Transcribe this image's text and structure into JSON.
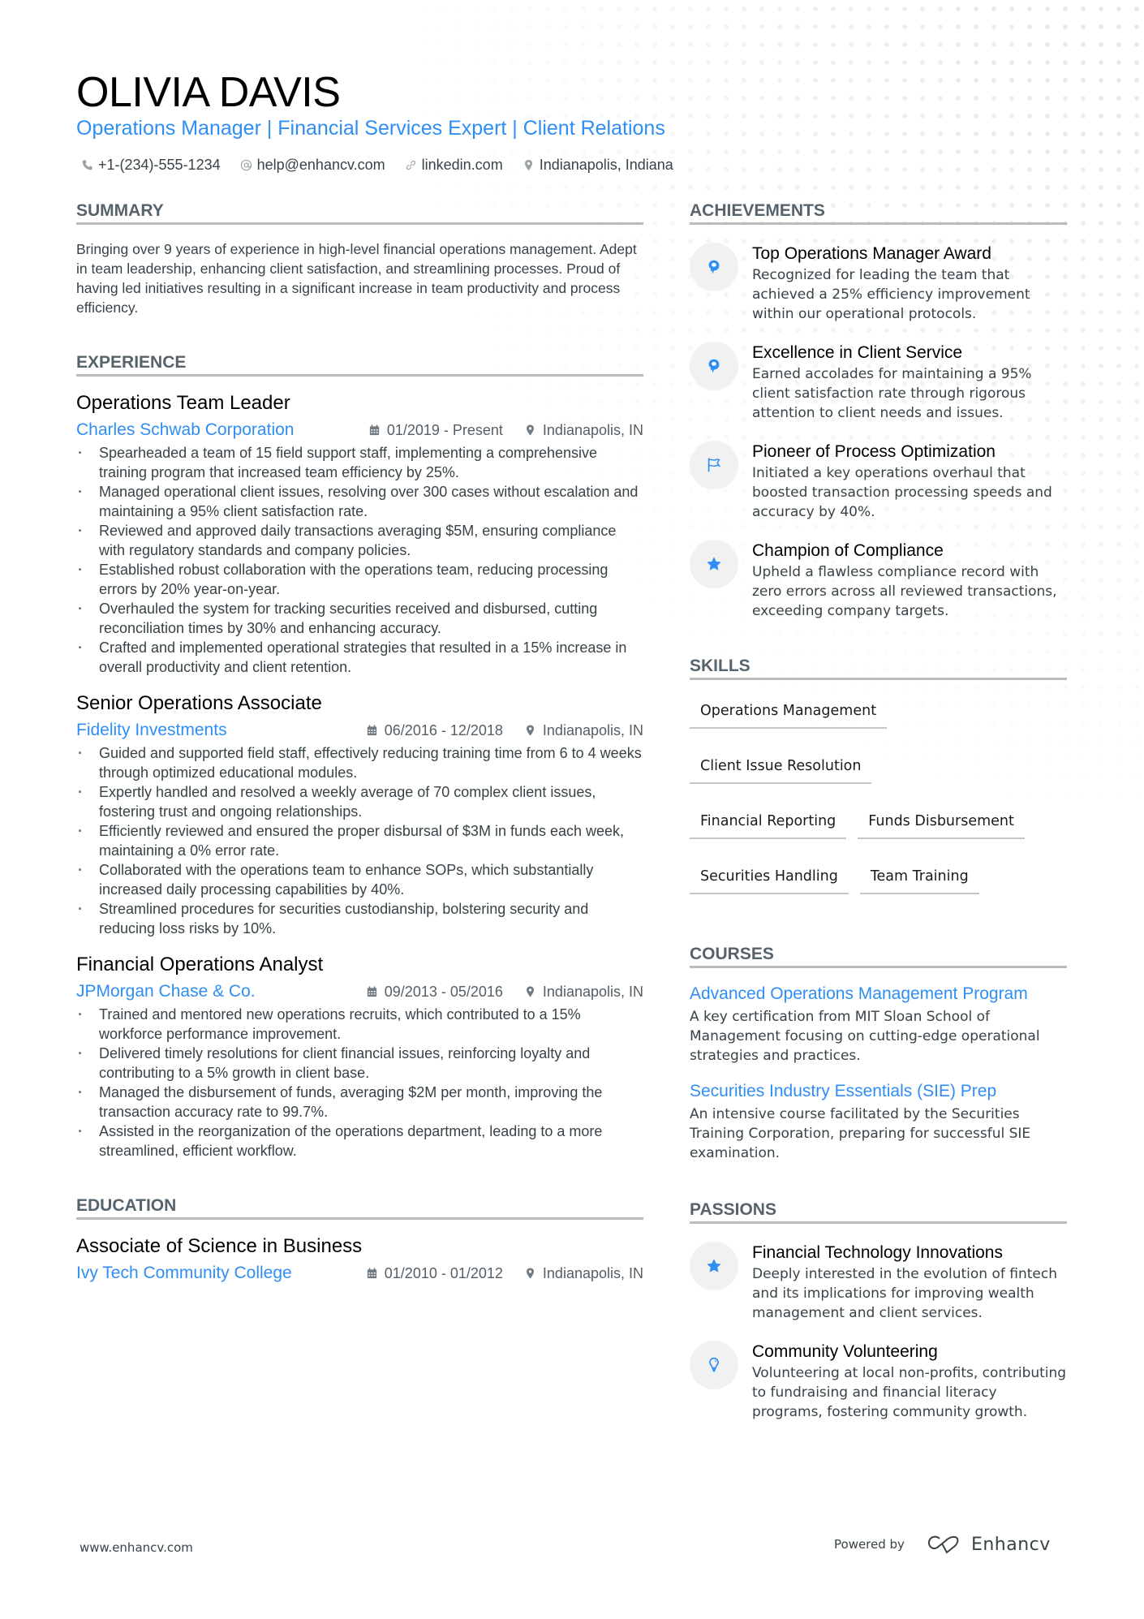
{
  "header": {
    "name": "OLIVIA DAVIS",
    "subtitle": "Operations Manager | Financial Services Expert | Client Relations",
    "contacts": [
      {
        "icon": "phone-icon",
        "text": "+1-(234)-555-1234"
      },
      {
        "icon": "at-icon",
        "text": "help@enhancv.com"
      },
      {
        "icon": "link-icon",
        "text": "linkedin.com"
      },
      {
        "icon": "location-pin-icon",
        "text": "Indianapolis, Indiana"
      }
    ]
  },
  "summary": {
    "title": "SUMMARY",
    "text": "Bringing over 9 years of experience in high-level financial operations management. Adept in team leadership, enhancing client satisfaction, and streamlining processes. Proud of having led initiatives resulting in a significant increase in team productivity and process efficiency."
  },
  "experience": {
    "title": "EXPERIENCE",
    "jobs": [
      {
        "role": "Operations Team Leader",
        "company": "Charles Schwab Corporation",
        "dates": "01/2019 - Present",
        "location": "Indianapolis, IN",
        "bullets": [
          "Spearheaded a team of 15 field support staff, implementing a comprehensive training program that increased team efficiency by 25%.",
          "Managed operational client issues, resolving over 300 cases without escalation and maintaining a 95% client satisfaction rate.",
          "Reviewed and approved daily transactions averaging $5M, ensuring compliance with regulatory standards and company policies.",
          "Established robust collaboration with the operations team, reducing processing errors by 20% year-on-year.",
          "Overhauled the system for tracking securities received and disbursed, cutting reconciliation times by 30% and enhancing accuracy.",
          "Crafted and implemented operational strategies that resulted in a 15% increase in overall productivity and client retention."
        ]
      },
      {
        "role": "Senior Operations Associate",
        "company": "Fidelity Investments",
        "dates": "06/2016 - 12/2018",
        "location": "Indianapolis, IN",
        "bullets": [
          "Guided and supported field staff, effectively reducing training time from 6 to 4 weeks through optimized educational modules.",
          "Expertly handled and resolved a weekly average of 70 complex client issues, fostering trust and ongoing relationships.",
          "Efficiently reviewed and ensured the proper disbursal of $3M in funds each week, maintaining a 0% error rate.",
          "Collaborated with the operations team to enhance SOPs, which substantially increased daily processing capabilities by 40%.",
          "Streamlined procedures for securities custodianship, bolstering security and reducing loss risks by 10%."
        ]
      },
      {
        "role": "Financial Operations Analyst",
        "company": "JPMorgan Chase & Co.",
        "dates": "09/2013 - 05/2016",
        "location": "Indianapolis, IN",
        "bullets": [
          "Trained and mentored new operations recruits, which contributed to a 15% workforce performance improvement.",
          "Delivered timely resolutions for client financial issues, reinforcing loyalty and contributing to a 5% growth in client base.",
          "Managed the disbursement of funds, averaging $2M per month, improving the transaction accuracy rate to 99.7%.",
          "Assisted in the reorganization of the operations department, leading to a more streamlined, efficient workflow."
        ]
      }
    ]
  },
  "education": {
    "title": "EDUCATION",
    "items": [
      {
        "degree": "Associate of Science in Business",
        "school": "Ivy Tech Community College",
        "dates": "01/2010 - 01/2012",
        "location": "Indianapolis, IN"
      }
    ]
  },
  "achievements": {
    "title": "ACHIEVEMENTS",
    "items": [
      {
        "icon": "head-brain-icon",
        "title": "Top Operations Manager Award",
        "desc": "Recognized for leading the team that achieved a 25% efficiency improvement within our operational protocols."
      },
      {
        "icon": "head-brain-icon",
        "title": "Excellence in Client Service",
        "desc": "Earned accolades for maintaining a 95% client satisfaction rate through rigorous attention to client needs and issues."
      },
      {
        "icon": "flag-icon",
        "title": "Pioneer of Process Optimization",
        "desc": "Initiated a key operations overhaul that boosted transaction processing speeds and accuracy by 40%."
      },
      {
        "icon": "star-icon",
        "title": "Champion of Compliance",
        "desc": "Upheld a flawless compliance record with zero errors across all reviewed transactions, exceeding company targets."
      }
    ]
  },
  "skills": {
    "title": "SKILLS",
    "items": [
      "Operations Management",
      "Client Issue Resolution",
      "Financial Reporting",
      "Funds Disbursement",
      "Securities Handling",
      "Team Training"
    ]
  },
  "courses": {
    "title": "COURSES",
    "items": [
      {
        "title": "Advanced Operations Management Program",
        "desc": "A key certification from MIT Sloan School of Management focusing on cutting-edge operational strategies and practices."
      },
      {
        "title": "Securities Industry Essentials (SIE) Prep",
        "desc": "An intensive course facilitated by the Securities Training Corporation, preparing for successful SIE examination."
      }
    ]
  },
  "passions": {
    "title": "PASSIONS",
    "items": [
      {
        "icon": "star-icon",
        "title": "Financial Technology Innovations",
        "desc": "Deeply interested in the evolution of fintech and its implications for improving wealth management and client services."
      },
      {
        "icon": "lightbulb-icon",
        "title": "Community Volunteering",
        "desc": "Volunteering at local non-profits, contributing to fundraising and financial literacy programs, fostering community growth."
      }
    ]
  },
  "footer": {
    "website": "www.enhancv.com",
    "powered_by": "Powered by",
    "brand": "Enhancv"
  },
  "colors": {
    "accent": "#2f8ef4",
    "text": "#384347",
    "rule": "#b8bcbf"
  }
}
